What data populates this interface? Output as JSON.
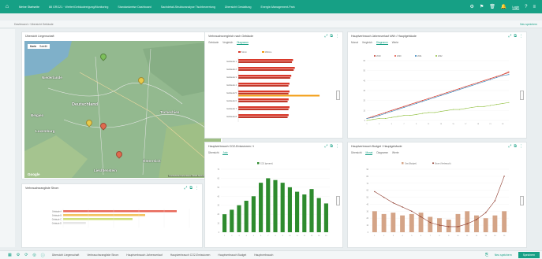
{
  "topbar": {
    "tabs": [
      "Meine Startseite",
      "88 GROZ1 · Wetter/Gebäudeeigung/Monitoring",
      "Standardweise Dashboard",
      "Sachdetail-Strukturanalyse Tischbewertung",
      "Übersicht Gestaltung",
      "Energie-Management-Park"
    ],
    "user": "Login"
  },
  "breadcrumb": {
    "path": "Dashboard > Übersicht Gebäude",
    "right": "Neu speichern"
  },
  "panels": {
    "map": {
      "title": "Übersicht Liegenschaft",
      "map_type": [
        "Karte",
        "Satellit"
      ],
      "labels": [
        {
          "text": "Niederlande"
        },
        {
          "text": "Deutschland"
        },
        {
          "text": "Belgien"
        },
        {
          "text": "Luxemburg"
        },
        {
          "text": "Tschechien"
        },
        {
          "text": "Liechtenstein"
        },
        {
          "text": "Österreich"
        }
      ],
      "google": "Google",
      "footer": "Kurzbefehle Kartendaten ©2024 Nutzungsbedingungen"
    },
    "bar_ranking": {
      "title": "Verbrauchsvergleich nach Gebäude",
      "tabs": [
        "Gebäude",
        "Vergleich",
        "Diagramm"
      ],
      "legend": [
        "Strom",
        "Wärme"
      ]
    },
    "bar_ranking_small": {
      "title": "Verbrauchsrangliste Strom"
    },
    "line_chart": {
      "title": "Hauptverbrauch Jahresverlauf kWh / Hauptgebäude",
      "tabs": [
        "Monat",
        "Vergleich",
        "Diagramm",
        "Werte"
      ],
      "legend": [
        "2019",
        "2020",
        "2021",
        "2022"
      ]
    },
    "green_bars": {
      "title": "Hauptverbrauch CO2-Emissionen / t",
      "tabs": [
        "Übersicht",
        "Jahr"
      ],
      "legend": [
        "CO2 (gesamt)"
      ]
    },
    "combo_chart": {
      "title": "Hauptverbrauch Budget / Hauptgebäude",
      "tabs": [
        "Übersicht",
        "Monat",
        "Diagramm",
        "Werte"
      ],
      "legend": [
        "Gas (Budget)",
        "Strom (Verbrauch)"
      ]
    }
  },
  "bottombar": {
    "tabs": [
      "Übersicht Liegenschaft",
      "Verbrauchsrangliste Strom",
      "Hauptverbrauch Jahresverlauf",
      "Hauptverbrauch CO2-Emissionen",
      "Hauptverbrauch Budget",
      "Hauptverbrauch"
    ],
    "links": [
      "Neu speichern"
    ],
    "save": "Speichern"
  },
  "chart_data": [
    {
      "type": "bar",
      "orientation": "horizontal",
      "categories": [
        "Gebäude 1",
        "Gebäude 2",
        "Gebäude 3",
        "Gebäude 4",
        "Gebäude 5",
        "Gebäude 6",
        "Gebäude 7",
        "Gebäude 8"
      ],
      "series": [
        {
          "name": "Strom",
          "values": [
            62,
            64,
            60,
            58,
            58,
            57,
            58,
            57
          ]
        },
        {
          "name": "Wärme",
          "values": [
            0,
            0,
            0,
            0,
            92,
            0,
            0,
            0
          ]
        }
      ],
      "xlim": [
        0,
        100
      ]
    },
    {
      "type": "bar",
      "orientation": "horizontal",
      "categories": [
        "Gebäude A",
        "Gebäude B",
        "Gebäude C",
        "Gebäude D"
      ],
      "series": [
        {
          "name": "",
          "values": [
            90,
            65,
            55,
            18
          ]
        }
      ],
      "xlim": [
        0,
        100
      ]
    },
    {
      "type": "line",
      "x": [
        1,
        2,
        3,
        4,
        5,
        6,
        7,
        8,
        9,
        10,
        11,
        12,
        13,
        14,
        15,
        16,
        17,
        18,
        19,
        20,
        21,
        22,
        23,
        24
      ],
      "series": [
        {
          "name": "2019",
          "values": [
            2,
            4,
            6,
            8,
            10,
            12,
            14,
            16,
            18,
            20,
            22,
            24,
            26,
            28,
            30,
            32,
            34,
            36,
            38,
            40,
            42,
            44,
            46,
            48
          ]
        },
        {
          "name": "2020",
          "values": [
            2,
            4,
            6,
            8,
            10,
            12,
            14,
            16,
            18,
            20,
            22,
            24,
            26,
            28,
            30,
            32,
            34,
            36,
            38,
            40,
            42,
            44,
            46,
            49
          ]
        },
        {
          "name": "2021",
          "values": [
            2,
            3,
            5,
            7,
            9,
            11,
            13,
            15,
            17,
            19,
            21,
            23,
            25,
            27,
            29,
            31,
            33,
            35,
            37,
            39,
            41,
            43,
            45,
            46
          ]
        },
        {
          "name": "2022",
          "values": [
            0,
            1,
            2,
            2,
            3,
            4,
            5,
            5,
            6,
            7,
            8,
            8,
            9,
            10,
            11,
            11,
            12,
            13,
            14,
            14,
            15,
            16,
            17,
            18
          ]
        }
      ],
      "ylim": [
        0,
        60
      ]
    },
    {
      "type": "bar",
      "categories": [
        "1",
        "2",
        "3",
        "4",
        "5",
        "6",
        "7",
        "8",
        "9",
        "10",
        "11",
        "12",
        "13",
        "14",
        "15"
      ],
      "series": [
        {
          "name": "CO2 (gesamt)",
          "values": [
            20,
            25,
            30,
            35,
            40,
            55,
            60,
            58,
            55,
            50,
            45,
            42,
            48,
            38,
            32
          ]
        }
      ],
      "ylim": [
        0,
        70
      ]
    },
    {
      "type": "bar",
      "categories": [
        "1",
        "2",
        "3",
        "4",
        "5",
        "6",
        "7",
        "8",
        "9",
        "10",
        "11",
        "12",
        "13",
        "14",
        "15"
      ],
      "series": [
        {
          "name": "Gas (Budget)",
          "values": [
            30,
            26,
            28,
            24,
            26,
            28,
            22,
            20,
            18,
            26,
            30,
            24,
            20,
            24,
            30
          ]
        },
        {
          "name": "Strom (Verbrauch)",
          "values": [
            58,
            50,
            42,
            36,
            30,
            22,
            14,
            10,
            8,
            8,
            12,
            18,
            28,
            45,
            80
          ]
        }
      ],
      "ylim": [
        0,
        90
      ]
    }
  ]
}
